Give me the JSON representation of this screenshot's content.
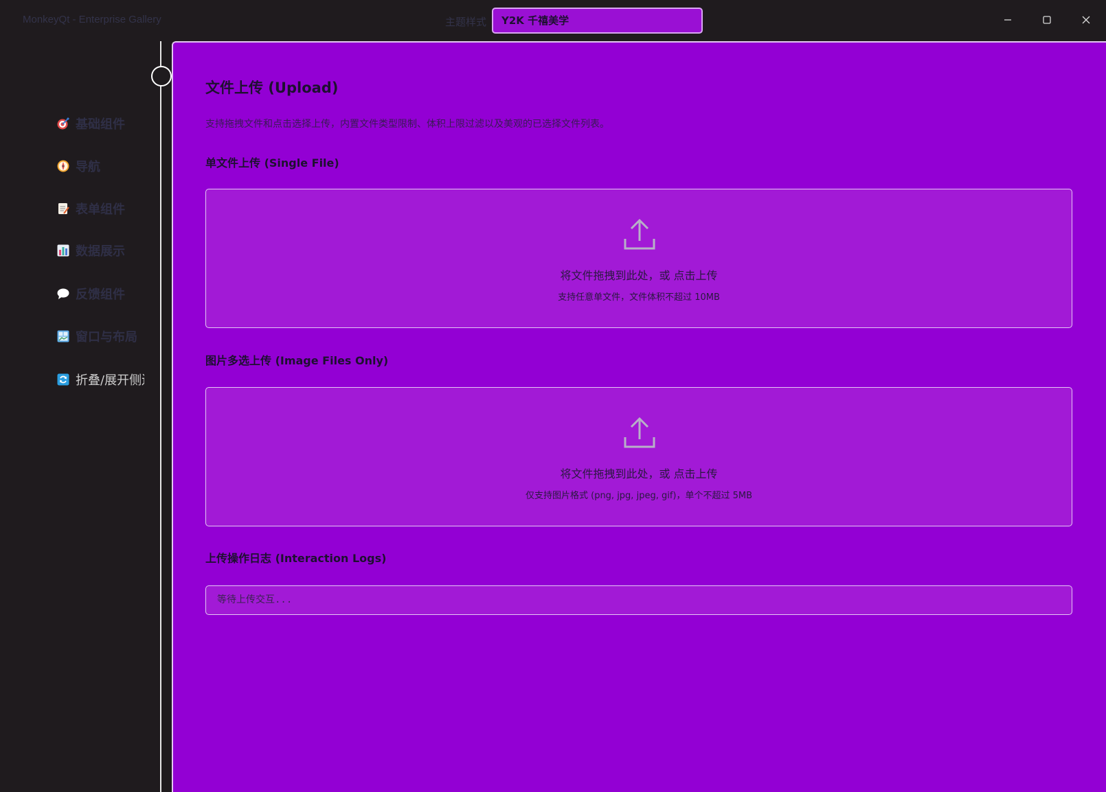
{
  "window": {
    "title": "MonkeyQt - Enterprise Gallery",
    "theme_label": "主题样式",
    "theme_value": "Y2K 千禧美学",
    "controls": [
      "minimize-icon",
      "maximize-icon",
      "close-icon"
    ]
  },
  "sidebar": {
    "items": [
      {
        "icon": "target-icon",
        "label": "基础组件"
      },
      {
        "icon": "compass-icon",
        "label": "导航"
      },
      {
        "icon": "memo-icon",
        "label": "表单组件"
      },
      {
        "icon": "bar-chart-icon",
        "label": "数据展示"
      },
      {
        "icon": "speech-bubble-icon",
        "label": "反馈组件"
      },
      {
        "icon": "window-icon",
        "label": "窗口与布局"
      },
      {
        "icon": "refresh-icon",
        "label": "折叠/展开侧边栏"
      }
    ]
  },
  "main": {
    "title": "文件上传 (Upload)",
    "description": "支持拖拽文件和点击选择上传，内置文件类型限制、体积上限过滤以及美观的已选择文件列表。",
    "single": {
      "heading": "单文件上传 (Single File)",
      "drop_text": "将文件拖拽到此处，或 点击上传",
      "hint": "支持任意单文件，文件体积不超过 10MB"
    },
    "multi": {
      "heading": "图片多选上传 (Image Files Only)",
      "drop_text": "将文件拖拽到此处，或 点击上传",
      "hint": "仅支持图片格式 (png, jpg, jpeg, gif)，单个不超过 5MB"
    },
    "logs": {
      "heading": "上传操作日志 (Interaction Logs)",
      "text": "等待上传交互..."
    }
  },
  "colors": {
    "background": "#1f1b1e",
    "panel": "#9300d4",
    "dropzone": "#a21ad6",
    "border": "#e5c8f4"
  }
}
